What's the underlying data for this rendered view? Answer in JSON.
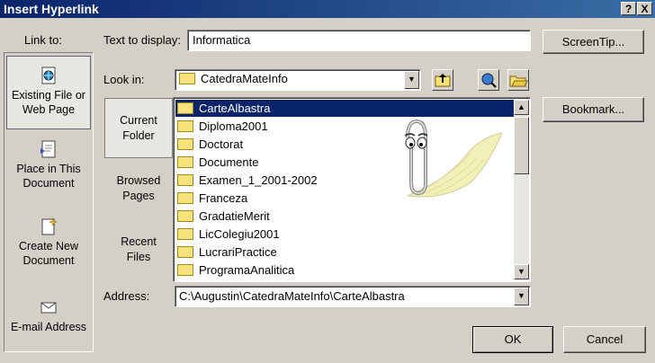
{
  "window": {
    "title": "Insert Hyperlink",
    "help_btn": "?",
    "close_btn": "X"
  },
  "link_to": {
    "label": "Link to:",
    "items": [
      {
        "line1": "Existing File or",
        "line2": "Web Page"
      },
      {
        "line1": "Place in This",
        "line2": "Document"
      },
      {
        "line1": "Create New",
        "line2": "Document"
      },
      {
        "line1": "E-mail Address",
        "line2": ""
      }
    ]
  },
  "text_to_display": {
    "label": "Text to display:",
    "value": "Informatica"
  },
  "screentip_button": "ScreenTip...",
  "look_in": {
    "label": "Look in:",
    "value": "CatedraMateInfo"
  },
  "bookmark_button": "Bookmark...",
  "nav": [
    {
      "line1": "Current",
      "line2": "Folder"
    },
    {
      "line1": "Browsed",
      "line2": "Pages"
    },
    {
      "line1": "Recent",
      "line2": "Files"
    }
  ],
  "files": [
    "CarteAlbastra",
    "Diploma2001",
    "Doctorat",
    "Documente",
    "Examen_1_2001-2002",
    "Franceza",
    "GradatieMerit",
    "LicColegiu2001",
    "LucrariPractice",
    "ProgramaAnalitica"
  ],
  "address": {
    "label": "Address:",
    "value": "C:\\Augustin\\CatedraMateInfo\\CarteAlbastra"
  },
  "ok_button": "OK",
  "cancel_button": "Cancel",
  "colors": {
    "title_start": "#0a246a",
    "title_end": "#3a6ea5",
    "selection": "#0a246a",
    "face": "#d4d0c8"
  }
}
